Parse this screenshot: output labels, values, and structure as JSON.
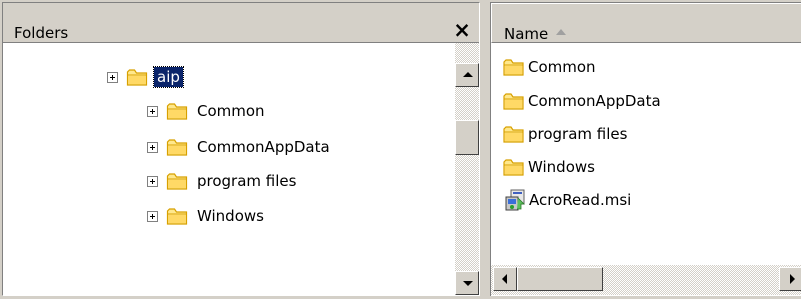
{
  "folders_pane": {
    "title": "Folders",
    "close_label": "×",
    "tree": [
      {
        "label": "aip",
        "selected": true
      },
      {
        "label": "Common",
        "selected": false
      },
      {
        "label": "CommonAppData",
        "selected": false
      },
      {
        "label": "program files",
        "selected": false
      },
      {
        "label": "Windows",
        "selected": false
      }
    ]
  },
  "files_pane": {
    "column_header": "Name",
    "sort_direction": "ascending",
    "items": [
      {
        "name": "Common",
        "icon": "folder-icon"
      },
      {
        "name": "CommonAppData",
        "icon": "folder-icon"
      },
      {
        "name": "program files",
        "icon": "folder-icon"
      },
      {
        "name": "Windows",
        "icon": "folder-icon"
      },
      {
        "name": "AcroRead.msi",
        "icon": "msi-installer-icon"
      }
    ]
  },
  "colors": {
    "face": "#d4d0c8",
    "selection": "#0a246a",
    "folder_fill": "#ffe88c",
    "folder_stroke": "#d8a000"
  }
}
